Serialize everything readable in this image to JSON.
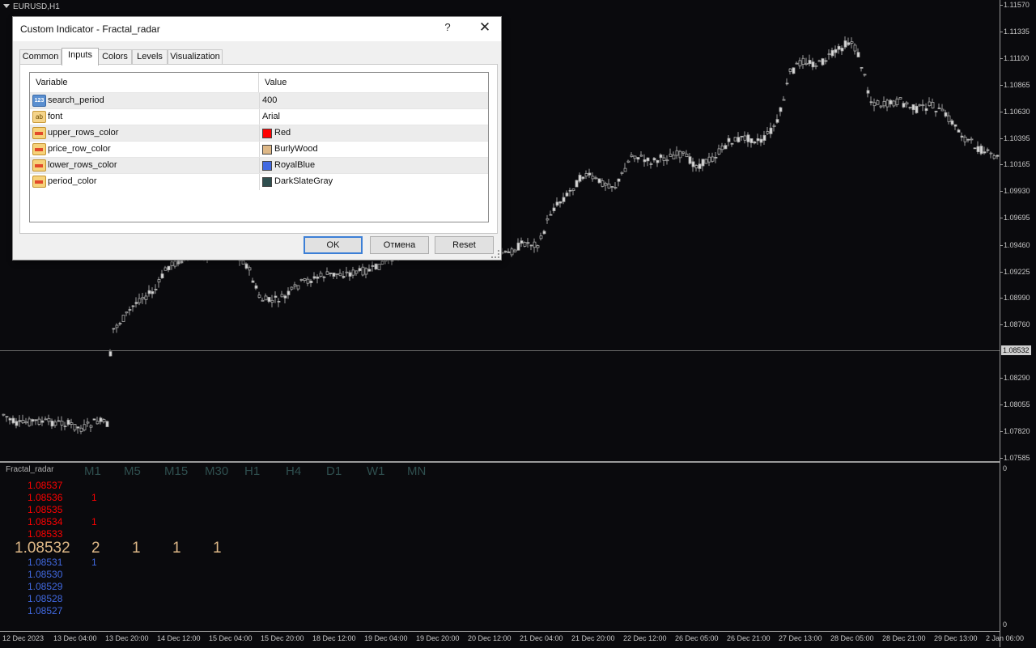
{
  "chart": {
    "title": "EURUSD,H1",
    "current_price": "1.08532",
    "price_labels": [
      "1.11570",
      "1.11335",
      "1.11100",
      "1.10865",
      "1.10630",
      "1.10395",
      "1.10165",
      "1.09930",
      "1.09695",
      "1.09460",
      "1.09225",
      "1.08990",
      "1.08760",
      "1.08532",
      "1.08290",
      "1.08055",
      "1.07820",
      "1.07585"
    ],
    "time_labels": [
      "12 Dec 2023",
      "13 Dec 04:00",
      "13 Dec 20:00",
      "14 Dec 12:00",
      "15 Dec 04:00",
      "15 Dec 20:00",
      "18 Dec 12:00",
      "19 Dec 04:00",
      "19 Dec 20:00",
      "20 Dec 12:00",
      "21 Dec 04:00",
      "21 Dec 20:00",
      "22 Dec 12:00",
      "26 Dec 05:00",
      "26 Dec 21:00",
      "27 Dec 13:00",
      "28 Dec 05:00",
      "28 Dec 21:00",
      "29 Dec 13:00",
      "2 Jan 06:00"
    ]
  },
  "indicator": {
    "label": "Fractal_radar",
    "axis_top": "0",
    "axis_bottom": "0",
    "timeframes": [
      "M1",
      "M5",
      "M15",
      "M30",
      "H1",
      "H4",
      "D1",
      "W1",
      "MN"
    ],
    "upper_rows": [
      {
        "price": "1.08537",
        "counts": [
          "",
          "",
          "",
          "",
          ""
        ]
      },
      {
        "price": "1.08536",
        "counts": [
          "1",
          "",
          "",
          "",
          ""
        ]
      },
      {
        "price": "1.08535",
        "counts": [
          "",
          "",
          "",
          "",
          ""
        ]
      },
      {
        "price": "1.08534",
        "counts": [
          "1",
          "",
          "",
          "",
          ""
        ]
      },
      {
        "price": "1.08533",
        "counts": [
          "",
          "",
          "",
          "",
          ""
        ]
      }
    ],
    "price_row": {
      "price": "1.08532",
      "counts": [
        "2",
        "1",
        "1",
        "1",
        ""
      ]
    },
    "lower_rows": [
      {
        "price": "1.08531",
        "counts": [
          "1",
          "",
          "",
          "",
          ""
        ]
      },
      {
        "price": "1.08530",
        "counts": [
          "",
          "",
          "",
          "",
          ""
        ]
      },
      {
        "price": "1.08529",
        "counts": [
          "",
          "",
          "",
          "",
          ""
        ]
      },
      {
        "price": "1.08528",
        "counts": [
          "",
          "",
          "",
          "",
          ""
        ]
      },
      {
        "price": "1.08527",
        "counts": [
          "",
          "",
          "",
          "",
          ""
        ]
      }
    ],
    "colors": {
      "upper": "#ff0000",
      "price": "#deb887",
      "lower": "#4169e1",
      "timeframe": "#2f4f4f"
    }
  },
  "dialog": {
    "title": "Custom Indicator - Fractal_radar",
    "help_glyph": "?",
    "close_glyph": "✕",
    "tabs": [
      "Common",
      "Inputs",
      "Colors",
      "Levels",
      "Visualization"
    ],
    "active_tab": "Inputs",
    "columns": {
      "variable": "Variable",
      "value": "Value"
    },
    "rows": [
      {
        "type": "int",
        "icon_text": "123",
        "variable": "search_period",
        "value": "400"
      },
      {
        "type": "string",
        "icon_text": "ab",
        "variable": "font",
        "value": "Arial"
      },
      {
        "type": "color",
        "variable": "upper_rows_color",
        "value": "Red",
        "swatch": "#ff0000"
      },
      {
        "type": "color",
        "variable": "price_row_color",
        "value": "BurlyWood",
        "swatch": "#deb887"
      },
      {
        "type": "color",
        "variable": "lower_rows_color",
        "value": "RoyalBlue",
        "swatch": "#4169e1"
      },
      {
        "type": "color",
        "variable": "period_color",
        "value": "DarkSlateGray",
        "swatch": "#2f4f4f"
      }
    ],
    "buttons": {
      "ok": "OK",
      "cancel": "Отмена",
      "reset": "Reset"
    }
  }
}
